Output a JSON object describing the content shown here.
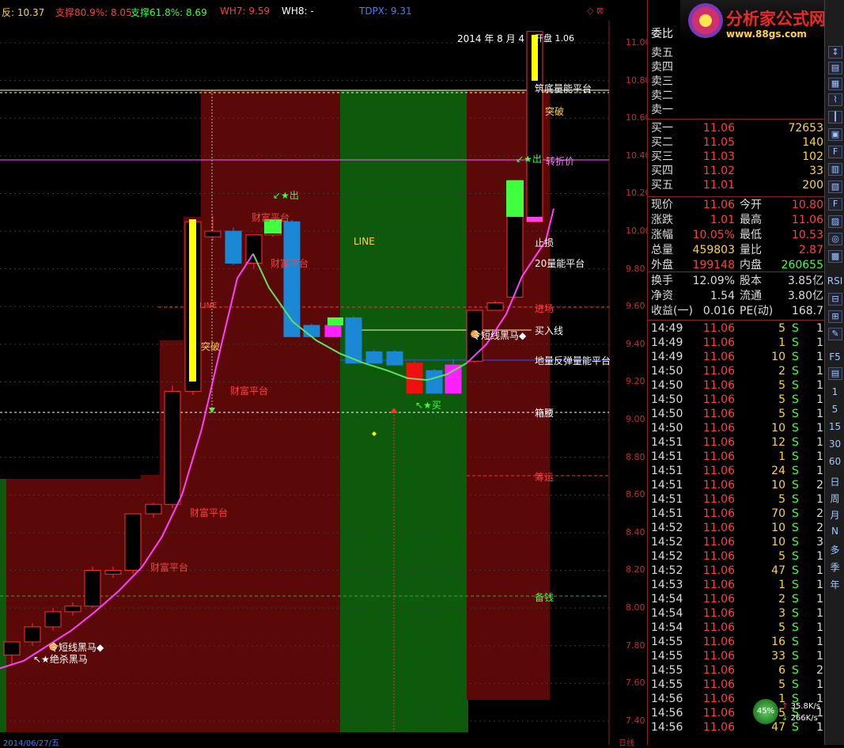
{
  "indicators": {
    "i1": {
      "label": "反: 10.37",
      "color": "#ffd24a"
    },
    "i2": {
      "label": "支撑80.9%: 8.05",
      "color": "#ff4040"
    },
    "i3": {
      "label": "支撑61.8%: 8.69",
      "color": "#40ff40"
    },
    "i4": {
      "label": "WH7: 9.59",
      "color": "#ff4040"
    },
    "i5": {
      "label": "WH8: -",
      "color": "#ffffff"
    },
    "i6": {
      "label": "TDPX: 9.31",
      "color": "#4080ff"
    }
  },
  "window_buttons": "◇ ⊠",
  "chart_date": "2014 年 8 月 4",
  "chart_info": "开盘  1.06",
  "status_left": "2014/06/27/五",
  "status_right": "日线",
  "price_axis": [
    "11.00",
    "10.80",
    "10.60",
    "10.40",
    "10.20",
    "10.00",
    "9.80",
    "9.60",
    "9.40",
    "9.20",
    "9.00",
    "8.80",
    "8.60",
    "8.40",
    "8.20",
    "8.00",
    "7.80",
    "7.60",
    "7.40"
  ],
  "labels": {
    "line": "LINE",
    "zhunong": "筑底量能平台",
    "chuhuo1": "↙★出",
    "chuhuo2": "↙★出",
    "zhuanzhe": "转折价",
    "zhisun": "止损",
    "liang20": "20量能平台",
    "jinchang": "进场",
    "mairu": "买入线",
    "difan": "地量反弹量能平台",
    "xiangyao": "箱腰",
    "choucang": "筹运",
    "beiyong": "备钱",
    "caifu1": "财富平台",
    "caifu2": "财富平台",
    "caifu3": "财富平台",
    "caifu4": "财富平台",
    "caifu5": "财富平台",
    "caifu6": "财富平台",
    "mai": "↖★买",
    "heima1": "令短线黑马◆",
    "heima2": "↖★绝杀黑马",
    "heima3": "令短线黑马◆",
    "dongtai1": "突破",
    "dongtai2": "突破",
    "dongtai3": "突破",
    "line2": "LINE"
  },
  "chart_data": {
    "type": "candlestick",
    "title": "",
    "ylim": [
      7.3,
      11.2
    ],
    "candles": [
      {
        "o": 7.75,
        "h": 7.82,
        "l": 7.7,
        "c": 7.82
      },
      {
        "o": 7.82,
        "h": 7.92,
        "l": 7.8,
        "c": 7.9
      },
      {
        "o": 7.9,
        "h": 8.0,
        "l": 7.88,
        "c": 7.98
      },
      {
        "o": 7.98,
        "h": 8.03,
        "l": 7.96,
        "c": 8.01
      },
      {
        "o": 8.01,
        "h": 8.22,
        "l": 8.0,
        "c": 8.2
      },
      {
        "o": 8.18,
        "h": 8.22,
        "l": 8.16,
        "c": 8.2
      },
      {
        "o": 8.2,
        "h": 8.5,
        "l": 8.18,
        "c": 8.5
      },
      {
        "o": 8.5,
        "h": 8.56,
        "l": 8.48,
        "c": 8.55
      },
      {
        "o": 8.55,
        "h": 9.18,
        "l": 8.53,
        "c": 9.15
      },
      {
        "o": 9.15,
        "h": 10.05,
        "l": 9.13,
        "c": 10.05
      },
      {
        "o": 9.97,
        "h": 10.08,
        "l": 9.95,
        "c": 10.0
      },
      {
        "o": 10.0,
        "h": 10.02,
        "l": 9.82,
        "c": 9.83
      },
      {
        "o": 9.83,
        "h": 9.98,
        "l": 9.8,
        "c": 9.98
      },
      {
        "o": 9.98,
        "h": 10.05,
        "l": 9.97,
        "c": 10.03
      },
      {
        "o": 10.05,
        "h": 10.06,
        "l": 9.44,
        "c": 9.44
      },
      {
        "o": 9.5,
        "h": 9.51,
        "l": 9.44,
        "c": 9.44
      },
      {
        "o": 9.5,
        "h": 9.54,
        "l": 9.44,
        "c": 9.44
      },
      {
        "o": 9.54,
        "h": 9.55,
        "l": 9.3,
        "c": 9.3
      },
      {
        "o": 9.36,
        "h": 9.37,
        "l": 9.3,
        "c": 9.3
      },
      {
        "o": 9.36,
        "h": 9.37,
        "l": 9.29,
        "c": 9.29
      },
      {
        "o": 9.3,
        "h": 9.31,
        "l": 9.14,
        "c": 9.14
      },
      {
        "o": 9.26,
        "h": 9.27,
        "l": 9.14,
        "c": 9.14
      },
      {
        "o": 9.29,
        "h": 9.32,
        "l": 9.14,
        "c": 9.14
      },
      {
        "o": 9.31,
        "h": 9.58,
        "l": 9.3,
        "c": 9.58
      },
      {
        "o": 9.58,
        "h": 9.63,
        "l": 9.58,
        "c": 9.62
      },
      {
        "o": 9.65,
        "h": 10.27,
        "l": 9.64,
        "c": 10.27
      },
      {
        "o": 10.27,
        "h": 10.28,
        "l": 10.08,
        "c": 10.08
      },
      {
        "o": 10.28,
        "h": 10.3,
        "l": 10.05,
        "c": 10.07
      },
      {
        "o": 10.05,
        "h": 11.06,
        "l": 10.05,
        "c": 11.06
      }
    ],
    "ma_line": [
      7.68,
      7.72,
      7.8,
      7.88,
      7.98,
      8.09,
      8.22,
      8.38,
      8.6,
      8.95,
      9.4,
      9.75,
      9.88,
      9.7,
      9.52,
      9.42,
      9.35,
      9.3,
      9.26,
      9.22,
      9.21,
      9.24,
      9.3,
      9.4,
      9.56,
      9.76,
      9.95,
      10.12
    ]
  },
  "quote": {
    "weibi": "委比",
    "sell": [
      {
        "k": "卖五",
        "p": "",
        "v": ""
      },
      {
        "k": "卖四",
        "p": "",
        "v": ""
      },
      {
        "k": "卖三",
        "p": "",
        "v": ""
      },
      {
        "k": "卖二",
        "p": "",
        "v": ""
      },
      {
        "k": "卖一",
        "p": "",
        "v": ""
      }
    ],
    "buy": [
      {
        "k": "买一",
        "p": "11.06",
        "v": "72653"
      },
      {
        "k": "买二",
        "p": "11.05",
        "v": "140"
      },
      {
        "k": "买三",
        "p": "11.03",
        "v": "102"
      },
      {
        "k": "买四",
        "p": "11.02",
        "v": "33"
      },
      {
        "k": "买五",
        "p": "11.01",
        "v": "200"
      }
    ],
    "stats": [
      {
        "k1": "现价",
        "v1": "11.06",
        "c1": "#ff4040",
        "k2": "今开",
        "v2": "10.80",
        "c2": "#ff4040"
      },
      {
        "k1": "涨跌",
        "v1": "1.01",
        "c1": "#ff4040",
        "k2": "最高",
        "v2": "11.06",
        "c2": "#ff4040"
      },
      {
        "k1": "涨幅",
        "v1": "10.05%",
        "c1": "#ff4040",
        "k2": "最低",
        "v2": "10.53",
        "c2": "#ff4040"
      },
      {
        "k1": "总量",
        "v1": "459803",
        "c1": "#ffd24a",
        "k2": "量比",
        "v2": "2.87",
        "c2": "#ff4040"
      },
      {
        "k1": "外盘",
        "v1": "199148",
        "c1": "#ff4040",
        "k2": "内盘",
        "v2": "260655",
        "c2": "#40ff40"
      }
    ],
    "stats2": [
      {
        "k1": "换手",
        "v1": "12.09%",
        "k2": "股本",
        "v2": "3.85亿"
      },
      {
        "k1": "净资",
        "v1": "1.54",
        "k2": "流通",
        "v2": "3.80亿"
      },
      {
        "k1": "收益(一)",
        "v1": "0.016",
        "k2": "PE(动)",
        "v2": "168.7"
      }
    ],
    "ticks": [
      {
        "t": "14:49",
        "p": "11.06",
        "v": "5",
        "s": "S",
        "n": "1"
      },
      {
        "t": "14:49",
        "p": "11.06",
        "v": "1",
        "s": "S",
        "n": "1"
      },
      {
        "t": "14:49",
        "p": "11.06",
        "v": "10",
        "s": "S",
        "n": "1"
      },
      {
        "t": "14:50",
        "p": "11.06",
        "v": "2",
        "s": "S",
        "n": "1"
      },
      {
        "t": "14:50",
        "p": "11.06",
        "v": "5",
        "s": "S",
        "n": "1"
      },
      {
        "t": "14:50",
        "p": "11.06",
        "v": "5",
        "s": "S",
        "n": "1"
      },
      {
        "t": "14:50",
        "p": "11.06",
        "v": "5",
        "s": "S",
        "n": "1"
      },
      {
        "t": "14:50",
        "p": "11.06",
        "v": "10",
        "s": "S",
        "n": "1"
      },
      {
        "t": "14:51",
        "p": "11.06",
        "v": "12",
        "s": "S",
        "n": "1"
      },
      {
        "t": "14:51",
        "p": "11.06",
        "v": "1",
        "s": "S",
        "n": "1"
      },
      {
        "t": "14:51",
        "p": "11.06",
        "v": "24",
        "s": "S",
        "n": "1"
      },
      {
        "t": "14:51",
        "p": "11.06",
        "v": "10",
        "s": "S",
        "n": "2"
      },
      {
        "t": "14:51",
        "p": "11.06",
        "v": "5",
        "s": "S",
        "n": "1"
      },
      {
        "t": "14:51",
        "p": "11.06",
        "v": "70",
        "s": "S",
        "n": "2"
      },
      {
        "t": "14:52",
        "p": "11.06",
        "v": "10",
        "s": "S",
        "n": "2"
      },
      {
        "t": "14:52",
        "p": "11.06",
        "v": "10",
        "s": "S",
        "n": "3"
      },
      {
        "t": "14:52",
        "p": "11.06",
        "v": "5",
        "s": "S",
        "n": "1"
      },
      {
        "t": "14:52",
        "p": "11.06",
        "v": "47",
        "s": "S",
        "n": "1"
      },
      {
        "t": "14:53",
        "p": "11.06",
        "v": "1",
        "s": "S",
        "n": "1"
      },
      {
        "t": "14:54",
        "p": "11.06",
        "v": "2",
        "s": "S",
        "n": "1"
      },
      {
        "t": "14:54",
        "p": "11.06",
        "v": "3",
        "s": "S",
        "n": "1"
      },
      {
        "t": "14:54",
        "p": "11.06",
        "v": "5",
        "s": "S",
        "n": "1"
      },
      {
        "t": "14:55",
        "p": "11.06",
        "v": "16",
        "s": "S",
        "n": "1"
      },
      {
        "t": "14:55",
        "p": "11.06",
        "v": "33",
        "s": "S",
        "n": "1"
      },
      {
        "t": "14:55",
        "p": "11.06",
        "v": "6",
        "s": "S",
        "n": "2"
      },
      {
        "t": "14:55",
        "p": "11.06",
        "v": "5",
        "s": "S",
        "n": "1"
      },
      {
        "t": "14:56",
        "p": "11.06",
        "v": "1",
        "s": "S",
        "n": "1"
      },
      {
        "t": "14:56",
        "p": "11.06",
        "v": "5",
        "s": "S",
        "n": "1"
      },
      {
        "t": "14:56",
        "p": "11.06",
        "v": "47",
        "s": "S",
        "n": "1"
      }
    ]
  },
  "logo": {
    "title": "分析家公式网",
    "url": "www.88gs.com"
  },
  "toolbar_text": [
    "RSI",
    "F5",
    "1",
    "5",
    "15",
    "30",
    "60",
    "日",
    "周",
    "月",
    "N",
    "多",
    "季",
    "年"
  ],
  "net": {
    "pct": "45%",
    "up": "35.8K/s",
    "down": "266K/s"
  }
}
